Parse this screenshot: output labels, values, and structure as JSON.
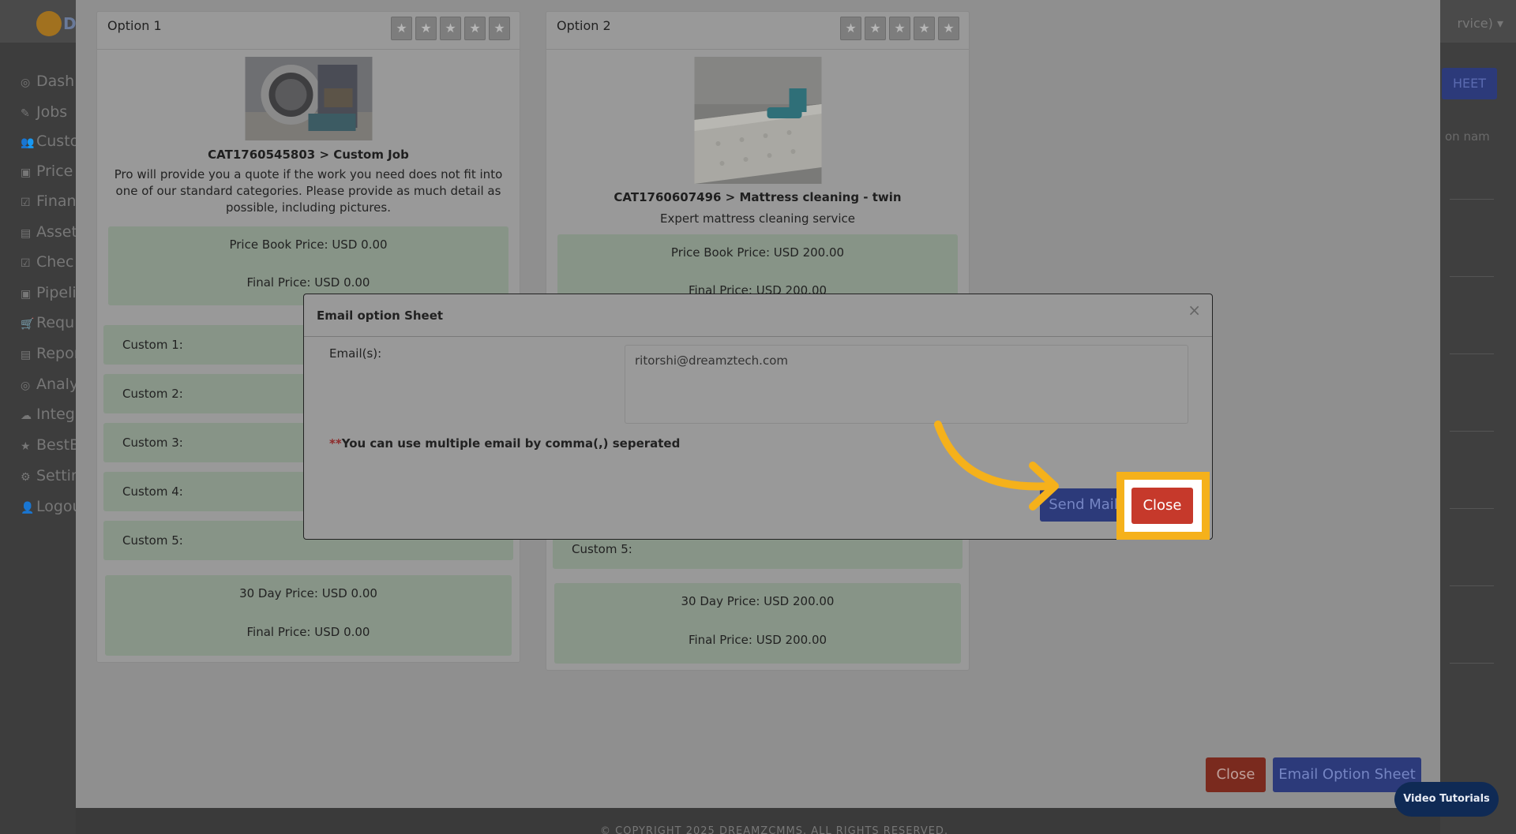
{
  "background": {
    "user_menu": "rvice) ▾",
    "sheet_button": "HEET",
    "right_placeholder": "on nam",
    "copyright": "© COPYRIGHT 2025 DREAMZCMMS. ALL RIGHTS RESERVED.",
    "sidebar": [
      {
        "icon": "◎",
        "label": "Dash"
      },
      {
        "icon": "✎",
        "label": "Jobs"
      },
      {
        "icon": "👥",
        "label": "Custo"
      },
      {
        "icon": "▣",
        "label": "Price"
      },
      {
        "icon": "☑",
        "label": "Finan"
      },
      {
        "icon": "▤",
        "label": "Asset"
      },
      {
        "icon": "☑",
        "label": "Chec"
      },
      {
        "icon": "▣",
        "label": "Pipeli"
      },
      {
        "icon": "🛒",
        "label": "Requ"
      },
      {
        "icon": "▤",
        "label": "Repor"
      },
      {
        "icon": "◎",
        "label": "Analy"
      },
      {
        "icon": "☁",
        "label": "Integ"
      },
      {
        "icon": "★",
        "label": "BestB"
      },
      {
        "icon": "⚙",
        "label": "Settin"
      },
      {
        "icon": "👤",
        "label": "Logou"
      }
    ]
  },
  "options": [
    {
      "title": "Option 1",
      "category": "CAT1760545803 > Custom Job",
      "description": "Pro will provide you a quote if the work you need does not fit into one of our standard categories. Please provide as much detail as possible, including pictures.",
      "price_book": "Price Book Price: USD 0.00",
      "final_price_top": "Final Price: USD 0.00",
      "customs": [
        "Custom 1:",
        "Custom 2:",
        "Custom 3:",
        "Custom 4:",
        "Custom 5:"
      ],
      "day30_price": "30 Day Price: USD 0.00",
      "final_price_bottom": "Final Price: USD 0.00"
    },
    {
      "title": "Option 2",
      "category": "CAT1760607496 > Mattress cleaning - twin",
      "description": "Expert mattress cleaning service",
      "price_book": "Price Book Price: USD 200.00",
      "final_price_top": "Final Price: USD 200.00",
      "customs": [
        "Custom 5:"
      ],
      "day30_price": "30 Day Price: USD 200.00",
      "final_price_bottom": "Final Price: USD 200.00"
    }
  ],
  "dialog": {
    "title": "Email option Sheet",
    "close_x": "×",
    "email_label": "Email(s):",
    "email_value": "ritorshi@dreamztech.com",
    "note_marker": "**",
    "note": "You can use multiple email by comma(,) seperated",
    "send_button": "Send Mail",
    "close_button": "Close"
  },
  "footer": {
    "close_button": "Close",
    "email_sheet_button": "Email Option Sheet",
    "video_tutorials": "Video Tutorials"
  },
  "colors": {
    "highlight": "#f5b11b",
    "close_red": "#c6392b",
    "primary_blue": "#2c3a7a"
  }
}
